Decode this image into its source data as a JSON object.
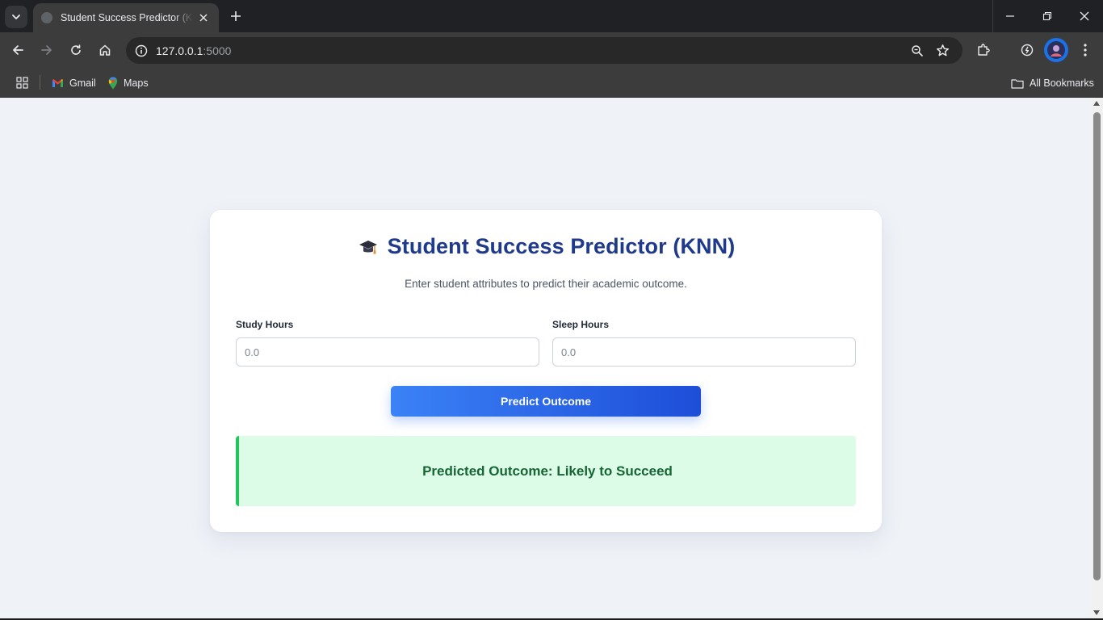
{
  "browser": {
    "tab_title": "Student Success Predictor (KNN)",
    "url_host": "127.0.0.1",
    "url_port": ":5000",
    "bookmarks": [
      {
        "label": "Gmail",
        "icon": "gmail-icon"
      },
      {
        "label": "Maps",
        "icon": "maps-icon"
      }
    ],
    "all_bookmarks_label": "All Bookmarks"
  },
  "page": {
    "title_icon": "graduation-cap-icon",
    "title": "Student Success Predictor (KNN)",
    "subtitle": "Enter student attributes to predict their academic outcome.",
    "fields": [
      {
        "label": "Study Hours",
        "placeholder": "0.0",
        "value": ""
      },
      {
        "label": "Sleep Hours",
        "placeholder": "0.0",
        "value": ""
      }
    ],
    "button_label": "Predict Outcome",
    "result_text": "Predicted Outcome: Likely to Succeed",
    "colors": {
      "title": "#1f3a8a",
      "button_start": "#3b82f6",
      "button_end": "#1d4ed8",
      "result_bg": "#dcfce7",
      "result_border": "#22c55e",
      "result_text": "#166534",
      "page_bg": "#eff2f7"
    }
  }
}
